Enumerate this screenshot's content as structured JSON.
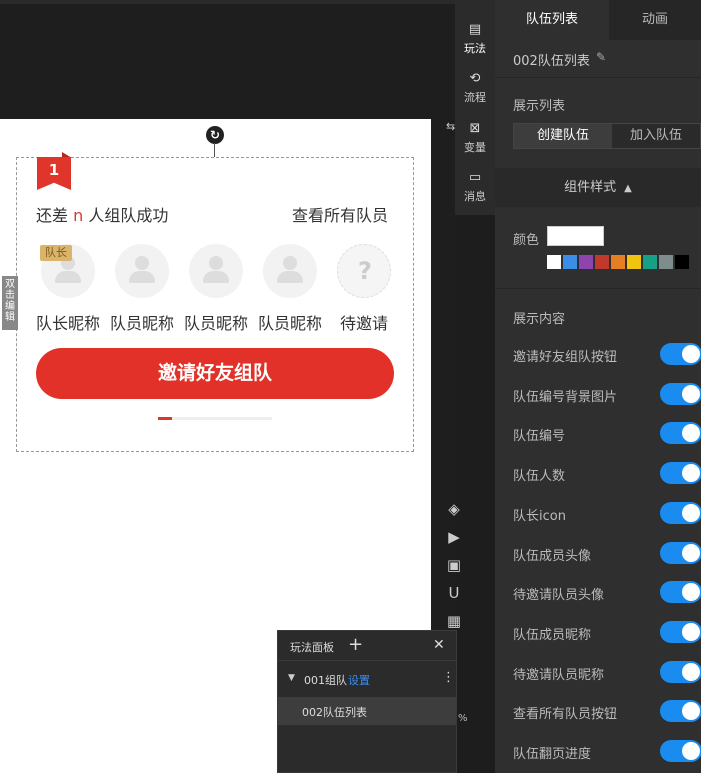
{
  "rail": {
    "items": [
      {
        "icon": "doc-edit-icon",
        "label": "玩法",
        "glyph": "▤"
      },
      {
        "icon": "flow-icon",
        "label": "流程",
        "glyph": "⟲"
      },
      {
        "icon": "variable-icon",
        "label": "变量",
        "glyph": "⊠"
      },
      {
        "icon": "message-icon",
        "label": "消息",
        "glyph": "▭"
      }
    ]
  },
  "card": {
    "rank": "1",
    "status_prefix": "还差 ",
    "status_n": "n",
    "status_suffix": " 人组队成功",
    "view_all": "查看所有队员",
    "leader_tag": "队长",
    "nicknames": [
      "队长昵称",
      "队员昵称",
      "队员昵称",
      "队员昵称",
      "待邀请"
    ],
    "pending_mark": "?",
    "invite_button": "邀请好友组队",
    "page_progress": 0.12,
    "double_click_edit": "双击编辑"
  },
  "panel": {
    "tabs": [
      "队伍列表",
      "动画"
    ],
    "component_name": "002队伍列表",
    "show_list_label": "展示列表",
    "segments": [
      "创建队伍",
      "加入队伍"
    ],
    "style_header": "组件样式",
    "color_label": "颜色",
    "color_value": "#ffffff",
    "swatches": [
      "#ffffff",
      "#3a8ee6",
      "#8e44ad",
      "#c0392b",
      "#e67e22",
      "#f1c40f",
      "#16a085",
      "#7f8c8d",
      "#000000"
    ],
    "content_label": "展示内容",
    "options": [
      "邀请好友组队按钮",
      "队伍编号背景图片",
      "队伍编号",
      "队伍人数",
      "队长icon",
      "队伍成员头像",
      "待邀请队员头像",
      "队伍成员昵称",
      "待邀请队员昵称",
      "查看所有队员按钮",
      "队伍翻页进度"
    ],
    "toggle_color": "#1a8cf0"
  },
  "play_panel": {
    "title": "玩法面板",
    "add": "+",
    "close": "✕",
    "group_name": "001组队",
    "group_setting": "设置",
    "child_name": "002队伍列表"
  },
  "misc": {
    "percent": "%"
  }
}
